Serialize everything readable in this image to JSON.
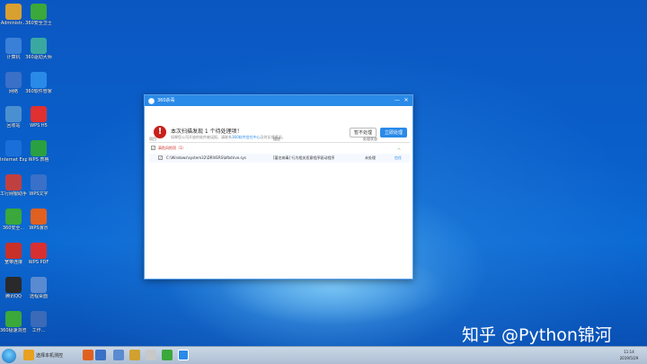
{
  "desktop": {
    "icons": [
      {
        "label": "Administr..."
      },
      {
        "label": "360安全卫士"
      },
      {
        "label": "计算机"
      },
      {
        "label": "360驱动大师"
      },
      {
        "label": "网络"
      },
      {
        "label": "360软件管家"
      },
      {
        "label": "回收站"
      },
      {
        "label": "WPS H5"
      },
      {
        "label": "Internet Explorer"
      },
      {
        "label": "WPS 表格"
      },
      {
        "label": "工行网银助手"
      },
      {
        "label": "WPS文字"
      },
      {
        "label": "360安全..."
      },
      {
        "label": "WPS演示"
      },
      {
        "label": "宽带连接"
      },
      {
        "label": "WPS PDF"
      },
      {
        "label": "腾讯QQ"
      },
      {
        "label": "远程桌面"
      },
      {
        "label": "360极速浏览器"
      },
      {
        "label": "工作..."
      }
    ],
    "watermark": "知乎 @Python锦河"
  },
  "dialog": {
    "title": "360杀毒",
    "min_glyph": "—",
    "close_glyph": "✕",
    "warn_glyph": "!",
    "heading": "本次扫描发现 1 个待处理项！",
    "subtitle_prefix": "如果您公司开放的软件被误报，请联系",
    "subtitle_link": "360软件信任中心",
    "subtitle_suffix": "及时反馈情况。",
    "later_button": "暂不处理",
    "now_button": "立即处理",
    "columns": {
      "item": "项目",
      "desc": "描述",
      "status": "处理状态"
    },
    "group": {
      "label": "高危风险项（1）",
      "toggle": "︿"
    },
    "rows": [
      {
        "path": "C:\\Windows\\system32\\DRIVERS\\bfbdrive.sys",
        "desc": "[著名病毒] 行为相关恶意程序驱动程序",
        "status": "未处理",
        "action": "信任"
      }
    ]
  },
  "taskbar": {
    "items": [
      {
        "label": "选择本机测控"
      }
    ],
    "clock": {
      "time": "11:14",
      "date": "2019/5/29"
    }
  }
}
